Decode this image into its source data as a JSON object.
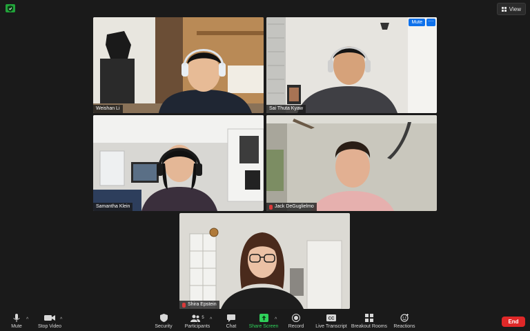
{
  "view": {
    "label": "View"
  },
  "participants": [
    {
      "name": "Weishan Li",
      "muted": false
    },
    {
      "name": "Sai Thuta Kyaw",
      "muted": false,
      "controls": {
        "mute": "Mute",
        "more": "···"
      }
    },
    {
      "name": "Samantha Klein",
      "muted": false
    },
    {
      "name": "Jack DeGuglielmo",
      "muted": true
    },
    {
      "name": "Shira Epstein",
      "muted": true
    }
  ],
  "toolbar": {
    "mute": "Mute",
    "stop_video": "Stop Video",
    "security": "Security",
    "participants": "Participants",
    "participants_count": "5",
    "chat": "Chat",
    "share_screen": "Share Screen",
    "record": "Record",
    "live_transcript": "Live Transcript",
    "breakout_rooms": "Breakout Rooms",
    "reactions": "Reactions",
    "end": "End"
  },
  "colors": {
    "share_green": "#2fd15a",
    "end_red": "#e02828",
    "mute_blue": "#0e71eb",
    "shield_green": "#22a33a"
  }
}
